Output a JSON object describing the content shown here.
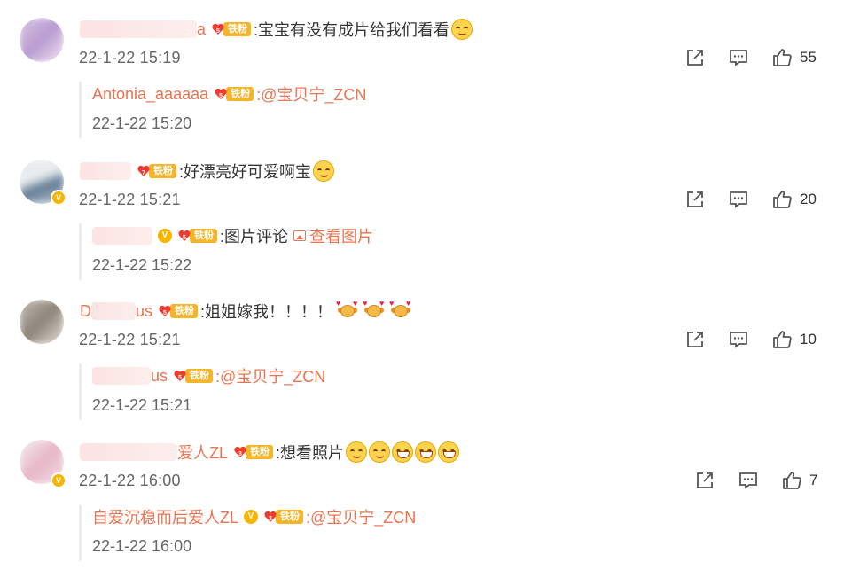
{
  "fan_tag": "铁粉",
  "colors": {
    "name": "#eb7350",
    "tag": "#f6b428",
    "text": "#333333",
    "muted": "#666666"
  },
  "comments": [
    {
      "name_suffix": "a",
      "text": ":宝宝有没有成片给我们看看",
      "time": "22-1-22 15:19",
      "likes": "55",
      "reply": {
        "name": "Antonia_aaaaaa",
        "text": ":@宝贝宁_ZCN",
        "time": "22-1-22 15:20"
      }
    },
    {
      "name_suffix": "",
      "text": ":好漂亮好可爱啊宝",
      "time": "22-1-22 15:21",
      "likes": "20",
      "reply": {
        "name": "",
        "text": ":图片评论",
        "image_link": "查看图片",
        "time": "22-1-22 15:22"
      }
    },
    {
      "name_prefix": "D",
      "name_suffix": "us",
      "text": ":姐姐嫁我！！！！",
      "time": "22-1-22 15:21",
      "likes": "10",
      "reply": {
        "name": "us",
        "text": ":@宝贝宁_ZCN",
        "time": "22-1-22 15:21"
      }
    },
    {
      "name_suffix": "爱人ZL",
      "text": ":想看照片",
      "time": "22-1-22 16:00",
      "likes": "7",
      "reply": {
        "name": "自爱沉稳而后爱人ZL",
        "text": ":@宝贝宁_ZCN",
        "time": "22-1-22 16:00"
      }
    }
  ],
  "icons": [
    "share-icon",
    "comment-icon",
    "like-icon",
    "heart-fan-icon",
    "image-icon"
  ]
}
